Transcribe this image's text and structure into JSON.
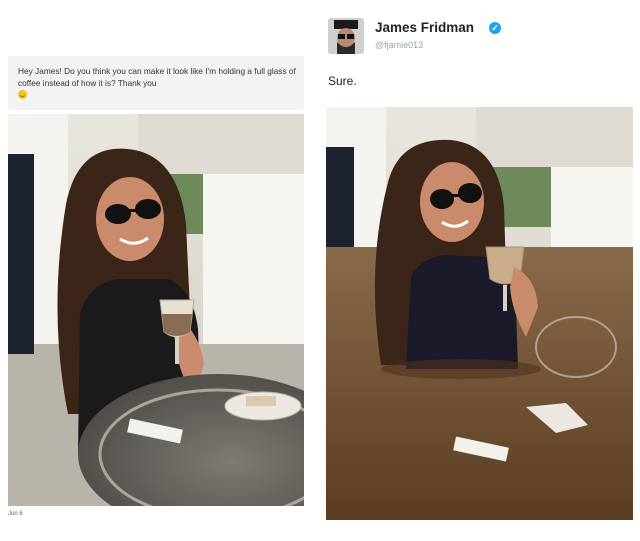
{
  "request": {
    "message": "Hey James! Do you think you can make it look like I'm holding a full glass of coffee instead of how it is? Thank you",
    "emoji": "smiling-face",
    "date": "Jun 6"
  },
  "reply": {
    "user_name": "James Fridman",
    "user_handle": "@fjamie013",
    "verified": true,
    "text": "Sure."
  },
  "colors": {
    "bubble_bg": "#f1f3f5",
    "verified_blue": "#1da1f2",
    "coffee": "#6b4a2a"
  }
}
